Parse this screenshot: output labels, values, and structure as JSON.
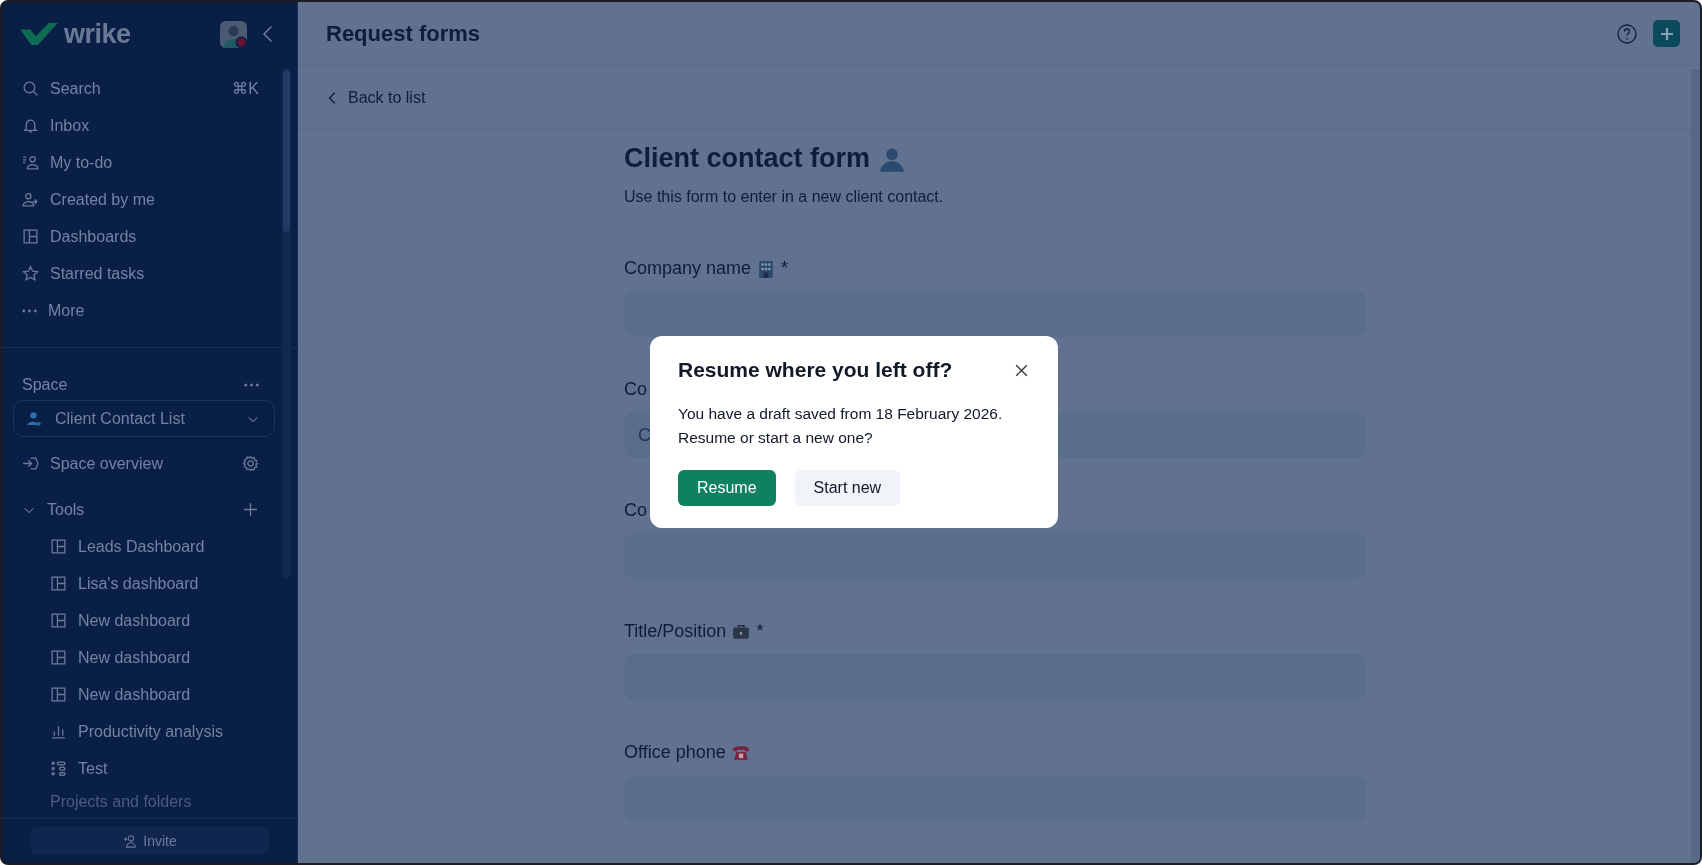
{
  "sidebar": {
    "logo": "wrike",
    "nav": [
      {
        "label": "Search",
        "shortcut": "⌘K"
      },
      {
        "label": "Inbox"
      },
      {
        "label": "My to-do"
      },
      {
        "label": "Created by me"
      },
      {
        "label": "Dashboards"
      },
      {
        "label": "Starred tasks"
      },
      {
        "label": "More"
      }
    ],
    "space_label": "Space",
    "space_select": {
      "value": "Client Contact List"
    },
    "space_overview": "Space overview",
    "tools": {
      "label": "Tools",
      "expanded": true,
      "items": [
        {
          "label": "Leads Dashboard",
          "kind": "dashboard"
        },
        {
          "label": "Lisa's dashboard",
          "kind": "dashboard"
        },
        {
          "label": "New dashboard",
          "kind": "dashboard"
        },
        {
          "label": "New dashboard",
          "kind": "dashboard"
        },
        {
          "label": "New dashboard",
          "kind": "dashboard"
        },
        {
          "label": "Productivity analysis",
          "kind": "analytics"
        },
        {
          "label": "Test",
          "kind": "workflow"
        }
      ]
    },
    "projects_label": "Projects and folders",
    "invite": "Invite"
  },
  "header": {
    "title": "Request forms"
  },
  "back_link": "Back to list",
  "form": {
    "title": "Client contact form",
    "description": "Use this form to enter in a new client contact.",
    "fields": [
      {
        "label": "Company name",
        "required_mark": "*"
      },
      {
        "label": "Co",
        "placeholder": "C"
      },
      {
        "label": "Co"
      },
      {
        "label": "Title/Position",
        "required_mark": "*"
      },
      {
        "label": "Office phone"
      }
    ]
  },
  "dialog": {
    "title": "Resume where you left off?",
    "message": "You have a draft saved from 18 February 2026. Resume or start a new one?",
    "buttons": [
      {
        "label": "Resume",
        "kind": "primary"
      },
      {
        "label": "Start new",
        "kind": "secondary"
      }
    ]
  }
}
